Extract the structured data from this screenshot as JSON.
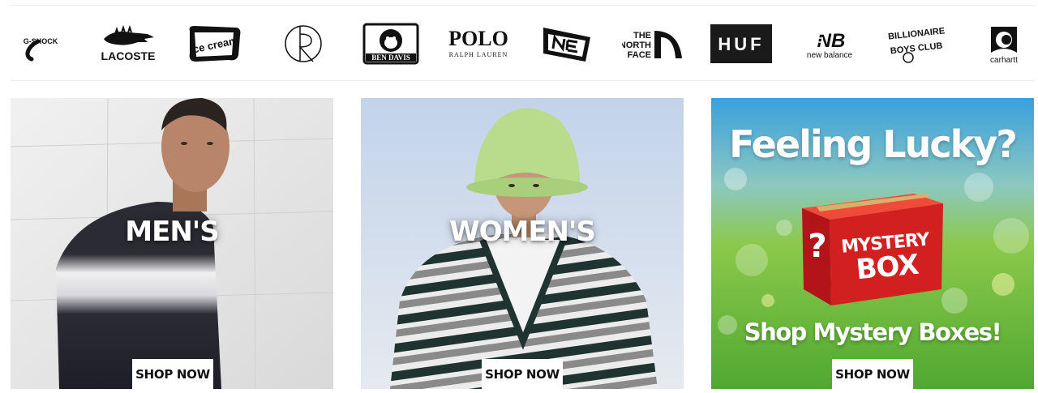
{
  "brands": [
    {
      "name": "G-Shock",
      "text": "G-SHOCK",
      "icon": "gshock-logo"
    },
    {
      "name": "Lacoste",
      "text": "LACOSTE",
      "icon": "crocodile-logo"
    },
    {
      "name": "Ice Cream",
      "text": "ice cream",
      "icon": "icecream-logo"
    },
    {
      "name": "Polar Skate Co",
      "text": "",
      "icon": "polar-circle-logo"
    },
    {
      "name": "Ben Davis",
      "text": "BEN DAVIS",
      "icon": "gorilla-logo"
    },
    {
      "name": "Polo Ralph Lauren",
      "text": "POLO",
      "subtext": "RALPH LAUREN",
      "icon": "polo-wordmark"
    },
    {
      "name": "New Era",
      "text": "",
      "icon": "newera-flag-logo"
    },
    {
      "name": "The North Face",
      "text": "THE NORTH FACE",
      "icon": "northface-logo"
    },
    {
      "name": "HUF",
      "text": "HUF",
      "icon": "huf-box-logo"
    },
    {
      "name": "New Balance",
      "text": "new balance",
      "icon": "nb-logo"
    },
    {
      "name": "Billionaire Boys Club",
      "text": "BILLIONAIRE BOYS CLUB",
      "icon": "bbc-logo"
    },
    {
      "name": "Carhartt",
      "text": "carhartt",
      "icon": "carhartt-c-logo"
    }
  ],
  "promos": {
    "mens": {
      "label": "MEN'S",
      "button": "SHOP NOW"
    },
    "womens": {
      "label": "WOMEN'S",
      "button": "SHOP NOW"
    },
    "mystery": {
      "title": "Feeling Lucky?",
      "box_line1": "MYSTERY",
      "box_line2": "BOX",
      "box_mark": "?",
      "subtitle": "Shop Mystery Boxes!",
      "button": "SHOP NOW"
    }
  },
  "colors": {
    "huf_bg": "#1a1a1a",
    "mystery_box": "#d21f1f",
    "mystery_green": "#5fb33a",
    "mystery_sky": "#3aa0de"
  }
}
